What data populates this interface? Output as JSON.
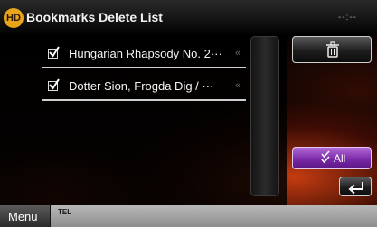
{
  "header": {
    "logo_text": "HD",
    "title": "Bookmarks Delete List",
    "clock": "--:--"
  },
  "list": {
    "items": [
      {
        "label": "Hungarian Rhapsody No. 2···",
        "checked": true
      },
      {
        "label": "Dotter Sion, Frogda Dig / ···",
        "checked": true
      }
    ]
  },
  "buttons": {
    "delete_icon": "trash-icon",
    "select_all_label": "All",
    "back_icon": "return-arrow-icon"
  },
  "bottom_bar": {
    "menu_label": "Menu",
    "status_text": "TEL"
  },
  "colors": {
    "accent_purple": "#7b2aa8",
    "logo_orange": "#e8a51a",
    "background_glow": "#e64614"
  }
}
